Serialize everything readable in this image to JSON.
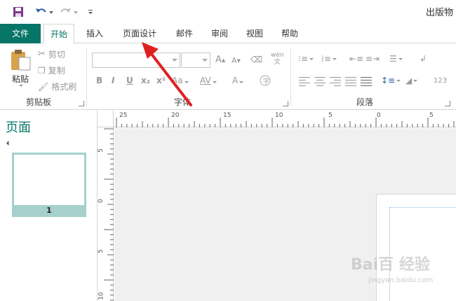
{
  "qat": {
    "title": "出版物"
  },
  "tabs": [
    {
      "label": "文件"
    },
    {
      "label": "开始"
    },
    {
      "label": "插入"
    },
    {
      "label": "页面设计"
    },
    {
      "label": "邮件"
    },
    {
      "label": "审阅"
    },
    {
      "label": "视图"
    },
    {
      "label": "帮助"
    }
  ],
  "clipboard": {
    "paste": "粘贴",
    "cut": "剪切",
    "copy": "复制",
    "format_painter": "格式刷",
    "label": "剪贴板"
  },
  "font": {
    "label": "字体",
    "bold": "B",
    "italic": "I",
    "underline": "U",
    "subscript": "x₂",
    "superscript": "x²",
    "case": "Aa",
    "spacing": "AV",
    "color": "A",
    "grow": "A",
    "shrink": "A",
    "pinyin": "wén"
  },
  "paragraph": {
    "label": "段落",
    "size": "123"
  },
  "pages_pane": {
    "title": "页面",
    "page_number": "1"
  },
  "rulers": {
    "h_labels": [
      "25",
      "20",
      "15",
      "10",
      "5",
      "0",
      "5"
    ],
    "v_labels": [
      "5",
      "0",
      "5",
      "10"
    ]
  },
  "watermark": {
    "text": "Bai百 经验",
    "sub": "jingyan.baidu.com"
  },
  "colors": {
    "accent": "#077568",
    "arrow": "#e02020"
  }
}
